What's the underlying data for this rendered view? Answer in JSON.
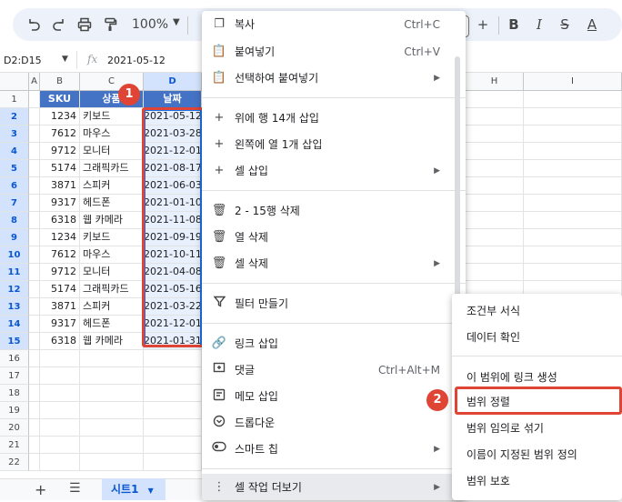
{
  "toolbar": {
    "zoom": "100%",
    "icons": [
      "undo-icon",
      "redo-icon",
      "print-icon",
      "paint-format-icon",
      "plus-icon",
      "bold-icon",
      "italic-icon",
      "strikethrough-icon",
      "text-color-icon"
    ]
  },
  "formula_bar": {
    "name_box": "D2:D15",
    "fx": "fx",
    "value": "2021-05-12"
  },
  "columns": [
    "A",
    "B",
    "C",
    "D",
    "H",
    "I"
  ],
  "rows": [
    "1",
    "2",
    "3",
    "4",
    "5",
    "6",
    "7",
    "8",
    "9",
    "10",
    "11",
    "12",
    "13",
    "14",
    "15",
    "16",
    "17",
    "18",
    "19",
    "20",
    "21",
    "22"
  ],
  "table": {
    "headers": {
      "sku": "SKU",
      "product": "상품",
      "date": "날짜"
    },
    "data": [
      {
        "sku": "1234",
        "product": "키보드",
        "date": "2021-05-12"
      },
      {
        "sku": "7612",
        "product": "마우스",
        "date": "2021-03-28"
      },
      {
        "sku": "9712",
        "product": "모니터",
        "date": "2021-12-01"
      },
      {
        "sku": "5174",
        "product": "그래픽카드",
        "date": "2021-08-17"
      },
      {
        "sku": "3871",
        "product": "스피커",
        "date": "2021-06-03"
      },
      {
        "sku": "9317",
        "product": "헤드폰",
        "date": "2021-01-10"
      },
      {
        "sku": "6318",
        "product": "웹 카메라",
        "date": "2021-11-08"
      },
      {
        "sku": "1234",
        "product": "키보드",
        "date": "2021-09-19"
      },
      {
        "sku": "7612",
        "product": "마우스",
        "date": "2021-10-11"
      },
      {
        "sku": "9712",
        "product": "모니터",
        "date": "2021-04-08"
      },
      {
        "sku": "5174",
        "product": "그래픽카드",
        "date": "2021-05-16"
      },
      {
        "sku": "3871",
        "product": "스피커",
        "date": "2021-03-22"
      },
      {
        "sku": "9317",
        "product": "헤드폰",
        "date": "2021-12-01"
      },
      {
        "sku": "6318",
        "product": "웹 카메라",
        "date": "2021-01-31"
      }
    ]
  },
  "sheet_tab": "시트1",
  "badges": {
    "one": "1",
    "two": "2"
  },
  "context_menu": {
    "copy": {
      "label": "복사",
      "shortcut": "Ctrl+C"
    },
    "paste": {
      "label": "붙여넣기",
      "shortcut": "Ctrl+V"
    },
    "paste_special": {
      "label": "선택하여 붙여넣기"
    },
    "insert_rows_above": {
      "label": "위에 행 14개 삽입"
    },
    "insert_col_left": {
      "label": "왼쪽에 열 1개 삽입"
    },
    "insert_cells": {
      "label": "셀 삽입"
    },
    "delete_rows": {
      "label": "2 - 15행 삭제"
    },
    "delete_column": {
      "label": "열 삭제"
    },
    "delete_cells": {
      "label": "셀 삭제"
    },
    "create_filter": {
      "label": "필터 만들기"
    },
    "insert_link": {
      "label": "링크 삽입"
    },
    "comment": {
      "label": "댓글",
      "shortcut": "Ctrl+Alt+M"
    },
    "insert_note": {
      "label": "메모 삽입"
    },
    "dropdown": {
      "label": "드롭다운"
    },
    "smart_chips": {
      "label": "스마트 칩"
    },
    "more_cell_actions": {
      "label": "셀 작업 더보기"
    }
  },
  "submenu": {
    "conditional_format": "조건부 서식",
    "data_validation": "데이터 확인",
    "link_to_range": "이 범위에 링크 생성",
    "sort_range": "범위 정렬",
    "randomize_range": "범위 임의로 섞기",
    "named_range": "이름이 지정된 범위 정의",
    "protect_range": "범위 보호"
  },
  "colors": {
    "header_fill": "#4472c4",
    "selection": "#1a73e8",
    "highlight": "#e04434"
  }
}
